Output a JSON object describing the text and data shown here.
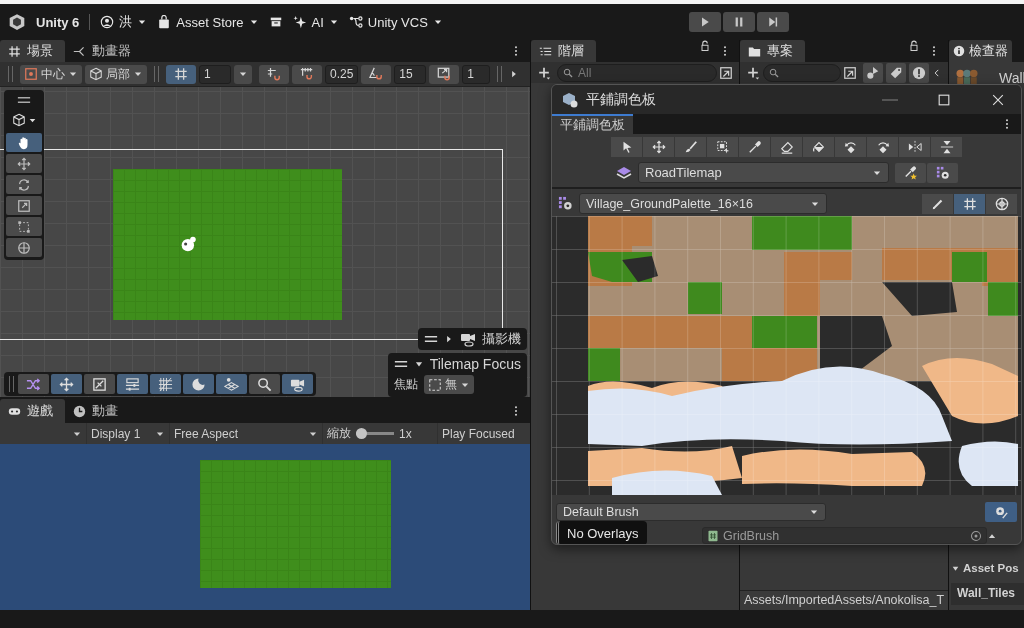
{
  "app_bar": {
    "product": "Unity 6",
    "account": "洪",
    "asset_store": "Asset Store",
    "ai": "AI",
    "vcs": "Unity VCS"
  },
  "scene_panel": {
    "tabs": [
      {
        "label": "場景",
        "selected": true
      },
      {
        "label": "動畫器",
        "selected": false
      }
    ],
    "toolbar": {
      "pivot": "中心",
      "space": "局部",
      "grid_visible": true,
      "grid_size": "1",
      "move_snap": "0.25",
      "rotate_snap": "15",
      "scale_snap": "1"
    },
    "tools": [
      {
        "selected": true
      },
      {
        "selected": false
      },
      {
        "selected": false
      },
      {
        "selected": false
      },
      {
        "selected": false
      },
      {
        "selected": false
      }
    ],
    "camera_overlay": "攝影機",
    "tilemap_focus": {
      "title": "Tilemap Focus",
      "label": "焦點",
      "value": "無"
    },
    "overlay_buttons": [
      {
        "selected": false
      },
      {
        "selected": true
      },
      {
        "selected": false
      },
      {
        "selected": true
      },
      {
        "selected": true
      },
      {
        "selected": true
      },
      {
        "selected": true
      },
      {
        "selected": false
      },
      {
        "selected": true
      }
    ]
  },
  "game_panel": {
    "tabs": [
      {
        "label": "遊戲",
        "selected": true
      },
      {
        "label": "動畫",
        "selected": false
      }
    ],
    "display": "Display 1",
    "aspect": "Free Aspect",
    "scale_label": "縮放",
    "scale": {
      "level": 0
    },
    "scale_value": "1x",
    "play_focused": "Play Focused"
  },
  "hierarchy": {
    "tab": "階層",
    "search_placeholder": "All"
  },
  "project": {
    "tab": "專案",
    "path": "Assets/ImportedAssets/Anokolisa_T"
  },
  "inspector": {
    "tab": "檢查器",
    "header": "Wall",
    "section": "Asset Pos",
    "field": "Wall_Tiles"
  },
  "palette_window": {
    "title": "平鋪調色板",
    "tab": "平鋪調色板",
    "tools": [
      {
        "selected": false
      },
      {
        "selected": false
      },
      {
        "selected": false
      },
      {
        "selected": false
      },
      {
        "selected": false
      },
      {
        "selected": false
      },
      {
        "selected": false
      },
      {
        "selected": false
      },
      {
        "selected": false
      },
      {
        "selected": false
      },
      {
        "selected": false
      }
    ],
    "target": "RoadTilemap",
    "palette": "Village_GroundPalette_16×16",
    "view_modes": [
      {
        "selected": false
      },
      {
        "selected": true
      },
      {
        "selected": false
      }
    ],
    "brush": "Default Brush",
    "brush_settings_on": true,
    "brush_script": "GridBrush",
    "overlays_tooltip": "No Overlays"
  }
}
